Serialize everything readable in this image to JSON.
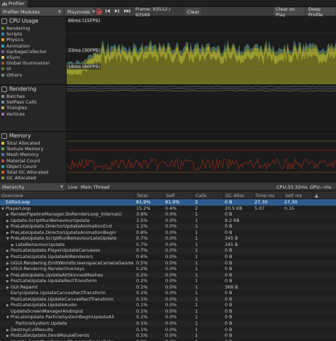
{
  "window": {
    "tab_title": "Profiler"
  },
  "toolbar": {
    "modules_label": "Profiler Modules",
    "playmode_label": "Playmode",
    "frame_label": "Frame: 93512 / 93569",
    "clear_label": "Clear",
    "clear_on_play_label": "Clear on Play",
    "deep_profile_label": "Deep Profile"
  },
  "cpu": {
    "title": "CPU Usage",
    "legend": [
      {
        "label": "Rendering",
        "color": "#5d8b2a"
      },
      {
        "label": "Scripts",
        "color": "#3a7fb3"
      },
      {
        "label": "Physics",
        "color": "#d9a227"
      },
      {
        "label": "Animation",
        "color": "#35a3b5"
      },
      {
        "label": "GarbageCollector",
        "color": "#7a5d9a"
      },
      {
        "label": "VSync",
        "color": "#c7c75a"
      },
      {
        "label": "Global Illumination",
        "color": "#8c5b3a"
      },
      {
        "label": "UI",
        "color": "#5d7a3a"
      },
      {
        "label": "Others",
        "color": "#6d8a8e"
      }
    ],
    "marks": [
      "66ms (15FPS)",
      "33ms (30FPS)",
      "16ms (60FPS)"
    ]
  },
  "rendering": {
    "title": "Rendering",
    "legend": [
      {
        "label": "Batches",
        "color": "#8a8a8a"
      },
      {
        "label": "SetPass Calls",
        "color": "#6b8ab5"
      },
      {
        "label": "Triangles",
        "color": "#b5a86b"
      },
      {
        "label": "Vertices",
        "color": "#9a6bb5"
      }
    ]
  },
  "memory": {
    "title": "Memory",
    "legend": [
      {
        "label": "Total Allocated",
        "color": "#d4b84a"
      },
      {
        "label": "Texture Memory",
        "color": "#5aa05a"
      },
      {
        "label": "Mesh Memory",
        "color": "#4a7ab5"
      },
      {
        "label": "Material Count",
        "color": "#b54a4a"
      },
      {
        "label": "Object Count",
        "color": "#3a9aa0"
      },
      {
        "label": "Total GC Allocated",
        "color": "#c86428"
      },
      {
        "label": "GC Allocated",
        "color": "#8a8a3a"
      }
    ]
  },
  "hierarchy_bar": {
    "view_label": "Hierarchy",
    "live_label": "Live",
    "thread_label": "Main Thread",
    "cpu_label": "CPU:33.32ms",
    "gpu_label": "GPU:--ms"
  },
  "table": {
    "headers": [
      "Overview",
      "Total",
      "Self",
      "Calls",
      "GC Alloc",
      "Time ms",
      "Self ms",
      "▲"
    ],
    "rows": [
      {
        "indent": 0,
        "caret": "",
        "name": "EditorLoop",
        "total": "81.9%",
        "self": "81.9%",
        "calls": "2",
        "gc": "0 B",
        "time": "27.30",
        "selfms": "27.30",
        "selected": true
      },
      {
        "indent": 0,
        "caret": "▼",
        "name": "PlayerLoop",
        "total": "15.2%",
        "self": "0.4%",
        "calls": "2",
        "gc": "20.5 KB",
        "time": "5.07",
        "selfms": "0.15"
      },
      {
        "indent": 1,
        "caret": "▶",
        "name": "RenderPipelineManager.DoRenderLoop_Internal()",
        "total": "3.6%",
        "self": "0.0%",
        "calls": "1",
        "gc": "0 B",
        "time": "",
        "selfms": ""
      },
      {
        "indent": 1,
        "caret": "▶",
        "name": "Update.ScriptRunBehaviourUpdate",
        "total": "3.5%",
        "self": "0.0%",
        "calls": "1",
        "gc": "9.2 KB",
        "time": "",
        "selfms": ""
      },
      {
        "indent": 1,
        "caret": "▶",
        "name": "PreLateUpdate.DirectorUpdateAnimationEnd",
        "total": "1.1%",
        "self": "0.0%",
        "calls": "1",
        "gc": "0 B",
        "time": "",
        "selfms": ""
      },
      {
        "indent": 1,
        "caret": "▶",
        "name": "PreLateUpdate.DirectorUpdateAnimationBegin",
        "total": "0.8%",
        "self": "0.0%",
        "calls": "1",
        "gc": "0 B",
        "time": "",
        "selfms": ""
      },
      {
        "indent": 1,
        "caret": "▼",
        "name": "PreLateUpdate.ScriptRunBehaviourLateUpdate",
        "total": "0.7%",
        "self": "0.0%",
        "calls": "1",
        "gc": "345 B",
        "time": "",
        "selfms": ""
      },
      {
        "indent": 2,
        "caret": "▶",
        "name": "LateBehaviourUpdate",
        "total": "0.7%",
        "self": "0.0%",
        "calls": "1",
        "gc": "345 B",
        "time": "",
        "selfms": ""
      },
      {
        "indent": 1,
        "caret": "▶",
        "name": "PostLateUpdate.PlayerUpdateCanvases",
        "total": "0.7%",
        "self": "0.0%",
        "calls": "1",
        "gc": "0 B",
        "time": "",
        "selfms": ""
      },
      {
        "indent": 1,
        "caret": "▶",
        "name": "PostLateUpdate.UpdateAllRenderers",
        "total": "0.6%",
        "self": "0.0%",
        "calls": "1",
        "gc": "0 B",
        "time": "",
        "selfms": ""
      },
      {
        "indent": 1,
        "caret": "▶",
        "name": "UGUI.Rendering.EmitWorldScreenspaceCameraGeometry",
        "total": "0.5%",
        "self": "0.0%",
        "calls": "1",
        "gc": "0 B",
        "time": "",
        "selfms": ""
      },
      {
        "indent": 1,
        "caret": "▶",
        "name": "UGUI.Rendering.RenderOverlays",
        "total": "0.2%",
        "self": "0.0%",
        "calls": "1",
        "gc": "0 B",
        "time": "",
        "selfms": ""
      },
      {
        "indent": 1,
        "caret": "▶",
        "name": "PreLateUpdate.UpdateAllSkinnedMeshes",
        "total": "0.2%",
        "self": "0.0%",
        "calls": "1",
        "gc": "0 B",
        "time": "",
        "selfms": ""
      },
      {
        "indent": 1,
        "caret": "▶",
        "name": "PostLateUpdate.UpdateRectTransform",
        "total": "0.2%",
        "self": "0.0%",
        "calls": "1",
        "gc": "0 B",
        "time": "",
        "selfms": ""
      },
      {
        "indent": 1,
        "caret": "▶",
        "name": "GUI.Repaint",
        "total": "0.1%",
        "self": "0.0%",
        "calls": "1",
        "gc": "368 B",
        "time": "",
        "selfms": ""
      },
      {
        "indent": 1,
        "caret": "",
        "name": "EarlyUpdate.UpdateCanvasRectTransform",
        "total": "0.1%",
        "self": "0.0%",
        "calls": "1",
        "gc": "0 B",
        "time": "",
        "selfms": ""
      },
      {
        "indent": 1,
        "caret": "",
        "name": "PostLateUpdate.UpdateCanvasRectTransform",
        "total": "0.1%",
        "self": "0.0%",
        "calls": "1",
        "gc": "0 B",
        "time": "",
        "selfms": ""
      },
      {
        "indent": 1,
        "caret": "▶",
        "name": "PostLateUpdate.UpdateAudio",
        "total": "0.1%",
        "self": "0.0%",
        "calls": "1",
        "gc": "0 B",
        "time": "",
        "selfms": ""
      },
      {
        "indent": 1,
        "caret": "",
        "name": "UpdateScreenManagerAndInput",
        "total": "0.1%",
        "self": "0.0%",
        "calls": "1",
        "gc": "0 B",
        "time": "",
        "selfms": ""
      },
      {
        "indent": 1,
        "caret": "▼",
        "name": "PreLateUpdate.ParticleSystemBeginUpdateAll",
        "total": "0.1%",
        "self": "0.0%",
        "calls": "1",
        "gc": "0 B",
        "time": "",
        "selfms": ""
      },
      {
        "indent": 2,
        "caret": "",
        "name": "ParticleSystem.Update",
        "total": "0.1%",
        "self": "0.0%",
        "calls": "1",
        "gc": "0 B",
        "time": "",
        "selfms": ""
      },
      {
        "indent": 1,
        "caret": "▶",
        "name": "DestroyCullResults",
        "total": "0.1%",
        "self": "0.0%",
        "calls": "1",
        "gc": "0 B",
        "time": "",
        "selfms": ""
      },
      {
        "indent": 1,
        "caret": "▶",
        "name": "PostLateUpdate.SendMouseEvents",
        "total": "0.1%",
        "self": "0.0%",
        "calls": "1",
        "gc": "0 B",
        "time": "",
        "selfms": ""
      },
      {
        "indent": 1,
        "caret": "▶",
        "name": "Update.ScriptRunDelayedDynamicFrameRate",
        "total": "0.0%",
        "self": "0.0%",
        "calls": "1",
        "gc": "0 B",
        "time": "",
        "selfms": ""
      }
    ]
  }
}
